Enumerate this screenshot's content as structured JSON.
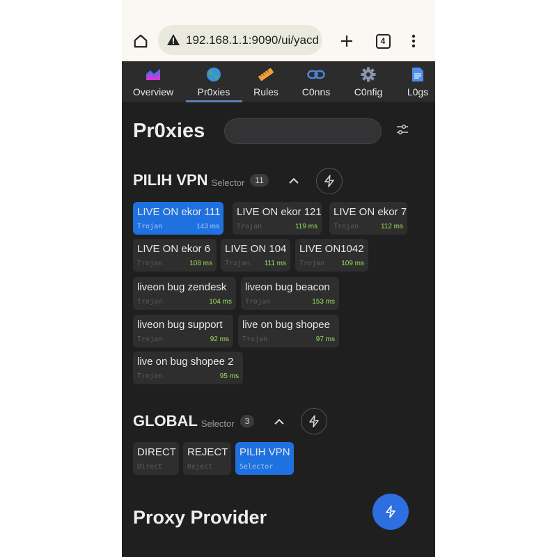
{
  "browser": {
    "url": "192.168.1.1:9090/ui/yacd",
    "tab_count": "4"
  },
  "nav": {
    "items": [
      {
        "label": "Overview",
        "icon": "overview-chart-icon"
      },
      {
        "label": "Pr0xies",
        "icon": "globe-icon"
      },
      {
        "label": "Rules",
        "icon": "ruler-icon"
      },
      {
        "label": "C0nns",
        "icon": "link-icon"
      },
      {
        "label": "C0nfig",
        "icon": "gear-icon"
      },
      {
        "label": "L0gs",
        "icon": "document-icon"
      }
    ],
    "active": "Pr0xies"
  },
  "page": {
    "title": "Pr0xies",
    "search_value": ""
  },
  "groups": [
    {
      "name": "PILIH VPN",
      "type": "Selector",
      "count": "11",
      "proxies": [
        {
          "name": "LIVE ON ekor 111",
          "type": "Trojan",
          "latency": "143 ms",
          "selected": true
        },
        {
          "name": "LIVE ON ekor 121",
          "type": "Trojan",
          "latency": "119 ms"
        },
        {
          "name": "LIVE ON ekor 7",
          "type": "Trojan",
          "latency": "112 ms"
        },
        {
          "name": "LIVE ON ekor 6",
          "type": "Trojan",
          "latency": "108 ms"
        },
        {
          "name": "LIVE ON 104",
          "type": "Trojan",
          "latency": "111 ms"
        },
        {
          "name": "LIVE ON1042",
          "type": "Trojan",
          "latency": "109 ms"
        },
        {
          "name": "liveon bug zendesk",
          "type": "Trojan",
          "latency": "104 ms"
        },
        {
          "name": "liveon bug beacon",
          "type": "Trojan",
          "latency": "153 ms"
        },
        {
          "name": "liveon bug support",
          "type": "Trojan",
          "latency": "92 ms"
        },
        {
          "name": "live on bug shopee",
          "type": "Trojan",
          "latency": "97 ms"
        },
        {
          "name": "live on bug shopee 2",
          "type": "Trojan",
          "latency": "95 ms"
        }
      ]
    },
    {
      "name": "GLOBAL",
      "type": "Selector",
      "count": "3",
      "proxies": [
        {
          "name": "DIRECT",
          "type": "Direct",
          "latency": ""
        },
        {
          "name": "REJECT",
          "type": "Reject",
          "latency": ""
        },
        {
          "name": "PILIH VPN",
          "type": "Selector",
          "latency": "",
          "selected": true
        }
      ]
    }
  ],
  "provider": {
    "title": "Proxy Provider"
  },
  "colors": {
    "accent": "#1f71e0",
    "latency_good": "#9be15d",
    "background": "#1f1f1f",
    "card": "#2e2e2e"
  }
}
